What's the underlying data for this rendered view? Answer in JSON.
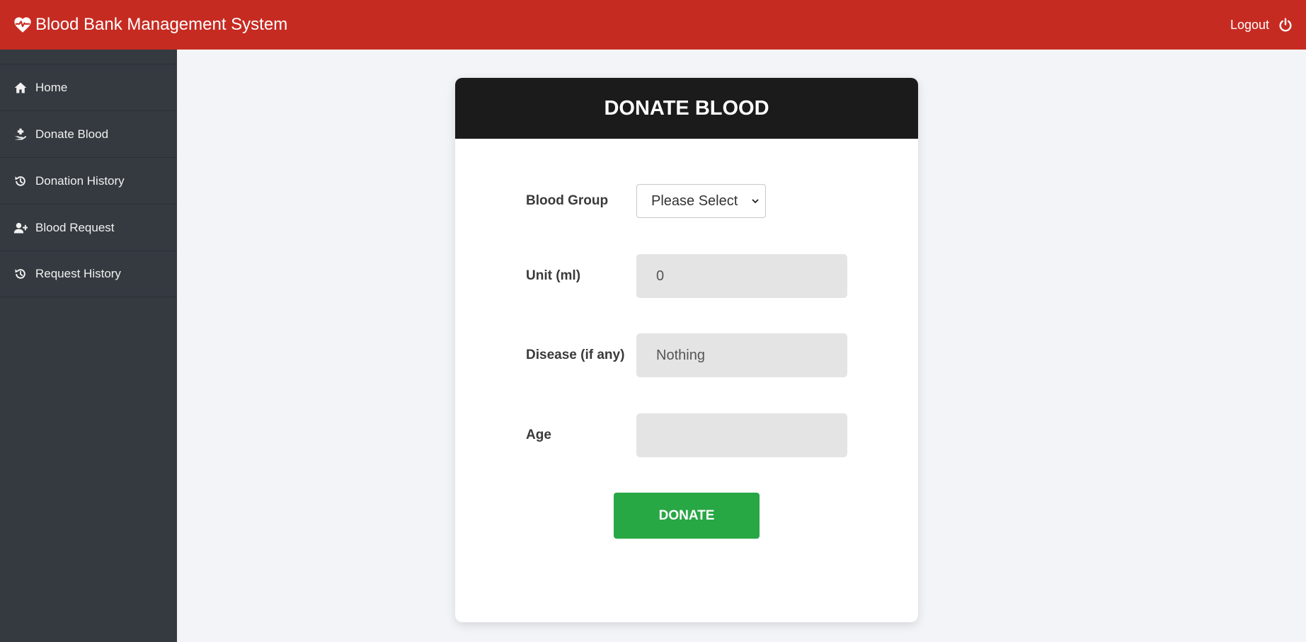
{
  "header": {
    "app_title": "Blood Bank Management System",
    "logout_label": "Logout",
    "brand_icon": "heart-pulse-icon",
    "logout_icon": "power-icon"
  },
  "sidebar": {
    "items": [
      {
        "label": "Home",
        "icon": "home-icon"
      },
      {
        "label": "Donate Blood",
        "icon": "hand-holding-medical-icon"
      },
      {
        "label": "Donation History",
        "icon": "history-icon"
      },
      {
        "label": "Blood Request",
        "icon": "user-plus-icon"
      },
      {
        "label": "Request History",
        "icon": "history-icon"
      }
    ]
  },
  "form": {
    "title": "DONATE BLOOD",
    "blood_group_label": "Blood Group",
    "blood_group_value": "Please Select",
    "unit_label": "Unit (ml)",
    "unit_placeholder": "0",
    "disease_label": "Disease (if any)",
    "disease_placeholder": "Nothing",
    "age_label": "Age",
    "age_placeholder": "",
    "submit_label": "DONATE"
  },
  "colors": {
    "topbar": "#c62b22",
    "sidebar": "#343a40",
    "card_header": "#1b1b1b",
    "donate_button": "#28a745"
  }
}
